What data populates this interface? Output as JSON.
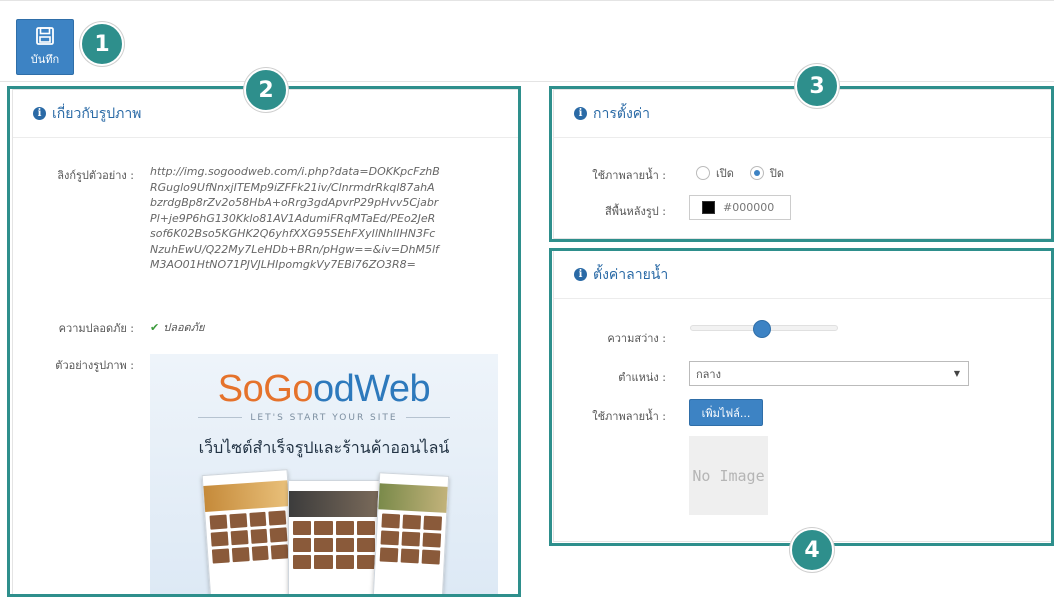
{
  "toolbar": {
    "save_label": "บันทึก",
    "save_icon": "floppy-disk-icon"
  },
  "badges": [
    "1",
    "2",
    "3",
    "4"
  ],
  "accent_color": "#2e8f8c",
  "primary_color": "#3d83c4",
  "about_panel": {
    "title": "เกี่ยวกับรูปภาพ",
    "link_label": "ลิงก์รูปตัวอย่าง :",
    "link_value": "http://img.sogoodweb.com/i.php?data=DOKKpcFzhBRGuglo9UfNnxjITEMp9iZFFk21iv/ClnrmdrRkql87ahAbzrdgBp8rZv2o58HbA+oRrg3gdApvrP29pHvv5CjabrPl+je9P6hG130Kklo81AV1AdumiFRqMTaEd/PEo2JeRsof6K02Bso5KGHK2Q6yhfXXG95SEhFXyIlNhlIHN3FcNzuhEwU/Q22My7LeHDb+BRn/pHgw==&iv=DhM5lfM3AO01HtNO71PJVJLHIpomgkVy7EBi76ZO3R8=",
    "safety_label": "ความปลอดภัย :",
    "safety_value": "ปลอดภัย",
    "preview_label": "ตัวอย่างรูปภาพ :",
    "preview": {
      "logo_part1": "SoGo",
      "logo_part2": "odWeb",
      "tagline": "LET'S START YOUR SITE",
      "headline": "เว็บไซต์สำเร็จรูปและร้านค้าออนไลน์"
    }
  },
  "settings_panel": {
    "title": "การตั้งค่า",
    "watermark_label": "ใช้ภาพลายน้ำ :",
    "options": [
      {
        "label": "เปิด",
        "selected": false
      },
      {
        "label": "ปิด",
        "selected": true
      }
    ],
    "bg_color_label": "สีพื้นหลังรูป :",
    "bg_color_value": "#000000"
  },
  "watermark_panel": {
    "title": "ตั้งค่าลายน้ำ",
    "brightness_label": "ความสว่าง :",
    "brightness_level": 0.5,
    "position_label": "ตำแหน่ง :",
    "position_value": "กลาง",
    "watermark_image_label": "ใช้ภาพลายน้ำ :",
    "add_file_label": "เพิ่มไฟล์...",
    "no_image_text": "No Image"
  }
}
